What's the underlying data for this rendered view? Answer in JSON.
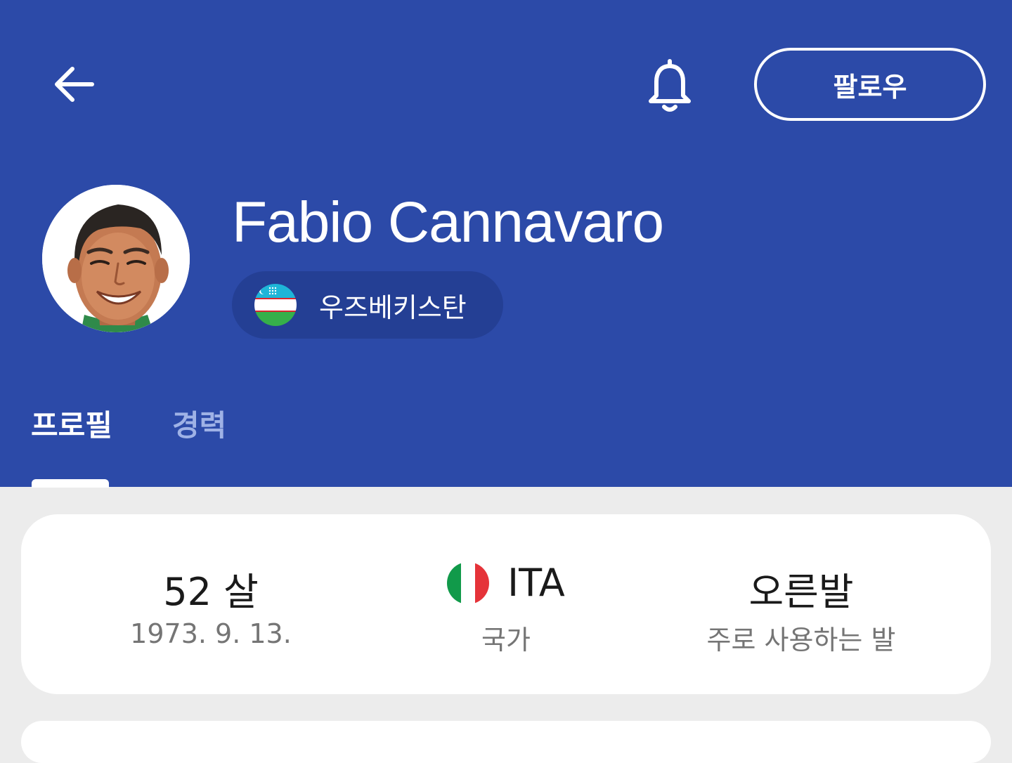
{
  "header": {
    "background_color": "#2c4aa8",
    "back_icon": "arrow-left-icon",
    "bell_icon": "bell-icon",
    "follow_label": "팔로우"
  },
  "player": {
    "name": "Fabio Cannavaro",
    "avatar_icon": "player-avatar",
    "team": {
      "name": "우즈베키스탄",
      "flag_icon": "uzbekistan-flag-icon"
    }
  },
  "tabs": [
    {
      "label": "프로필",
      "active": true
    },
    {
      "label": "경력",
      "active": false
    }
  ],
  "info": {
    "age": {
      "value": "52 살",
      "sub": "1973. 9. 13."
    },
    "nation": {
      "value": "ITA",
      "sub": "국가",
      "flag_icon": "italy-flag-icon"
    },
    "foot": {
      "value": "오른발",
      "sub": "주로 사용하는 발"
    }
  }
}
